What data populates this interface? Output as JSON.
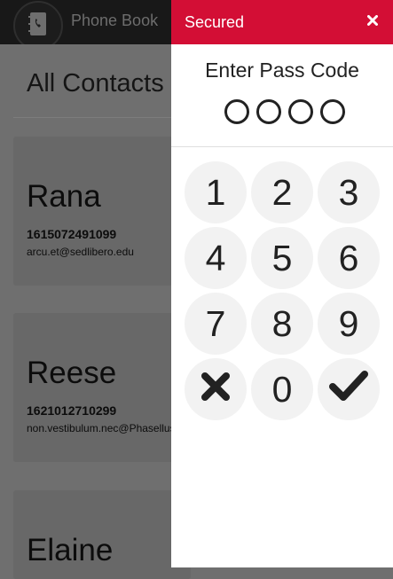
{
  "app": {
    "title": "Phone Book",
    "section_title": "All Contacts",
    "logo_icon": "address-book-icon",
    "contacts": [
      {
        "name": "Rana",
        "phone": "1615072491099",
        "email": "arcu.et@sedlibero.edu"
      },
      {
        "name": "Reese",
        "phone": "1621012710299",
        "email": "non.vestibulum.nec@Phasellus"
      },
      {
        "name": "Elaine",
        "phone": "",
        "email": ""
      }
    ]
  },
  "passcode": {
    "header_title": "Secured",
    "close_icon": "close-icon",
    "prompt": "Enter Pass Code",
    "entered_digits": 0,
    "total_digits": 4,
    "keys": {
      "k1": "1",
      "k2": "2",
      "k3": "3",
      "k4": "4",
      "k5": "5",
      "k6": "6",
      "k7": "7",
      "k8": "8",
      "k9": "9",
      "k0": "0",
      "clear_icon": "clear-x-icon",
      "confirm_icon": "checkmark-icon"
    },
    "colors": {
      "accent": "#d30e35",
      "key_bg": "#f2f2f2"
    }
  }
}
